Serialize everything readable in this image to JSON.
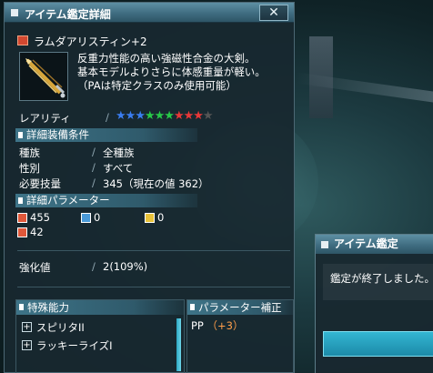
{
  "window": {
    "title": "アイテム鑑定詳細",
    "close_label": "✕"
  },
  "item": {
    "name": "ラムダアリスティン+2",
    "description": [
      "反重力性能の高い強磁性合金の大剣。",
      "基本モデルよりさらに体感重量が軽い。",
      "（PAは特定クラスのみ使用可能）"
    ],
    "rarity_label": "レアリティ",
    "rarity_stars": [
      {
        "color": "#3a7df0"
      },
      {
        "color": "#3a7df0"
      },
      {
        "color": "#3a7df0"
      },
      {
        "color": "#28c848"
      },
      {
        "color": "#28c848"
      },
      {
        "color": "#28c848"
      },
      {
        "color": "#e83838"
      },
      {
        "color": "#e83838"
      },
      {
        "color": "#e83838"
      },
      {
        "color": "#555555"
      }
    ]
  },
  "requirements": {
    "header": "詳細装備条件",
    "rows": [
      {
        "label": "種族",
        "value": "全種族"
      },
      {
        "label": "性別",
        "value": "すべて"
      },
      {
        "label": "必要技量",
        "value": "345（現在の値 362）"
      }
    ]
  },
  "parameters": {
    "header": "詳細パラメーター",
    "stats": [
      {
        "icon": "striking-attack-icon",
        "icon_color": "#e0583a",
        "value": "455"
      },
      {
        "icon": "ranged-attack-icon",
        "icon_color": "#4a9ad8",
        "value": "0"
      },
      {
        "icon": "technique-attack-icon",
        "icon_color": "#e8c23a",
        "value": "0"
      },
      {
        "icon": "element-fire-icon",
        "icon_color": "#e0583a",
        "value": "42"
      }
    ]
  },
  "enhancement": {
    "label": "強化値",
    "value": "2(109%)"
  },
  "special_abilities": {
    "header": "特殊能力",
    "items": [
      "スピリタII",
      "ラッキーライズI"
    ]
  },
  "param_bonus": {
    "header": "パラメーター補正",
    "label": "PP",
    "value": "（+3）"
  },
  "dialog": {
    "title": "アイテム鑑定",
    "message": "鑑定が終了しました。"
  }
}
